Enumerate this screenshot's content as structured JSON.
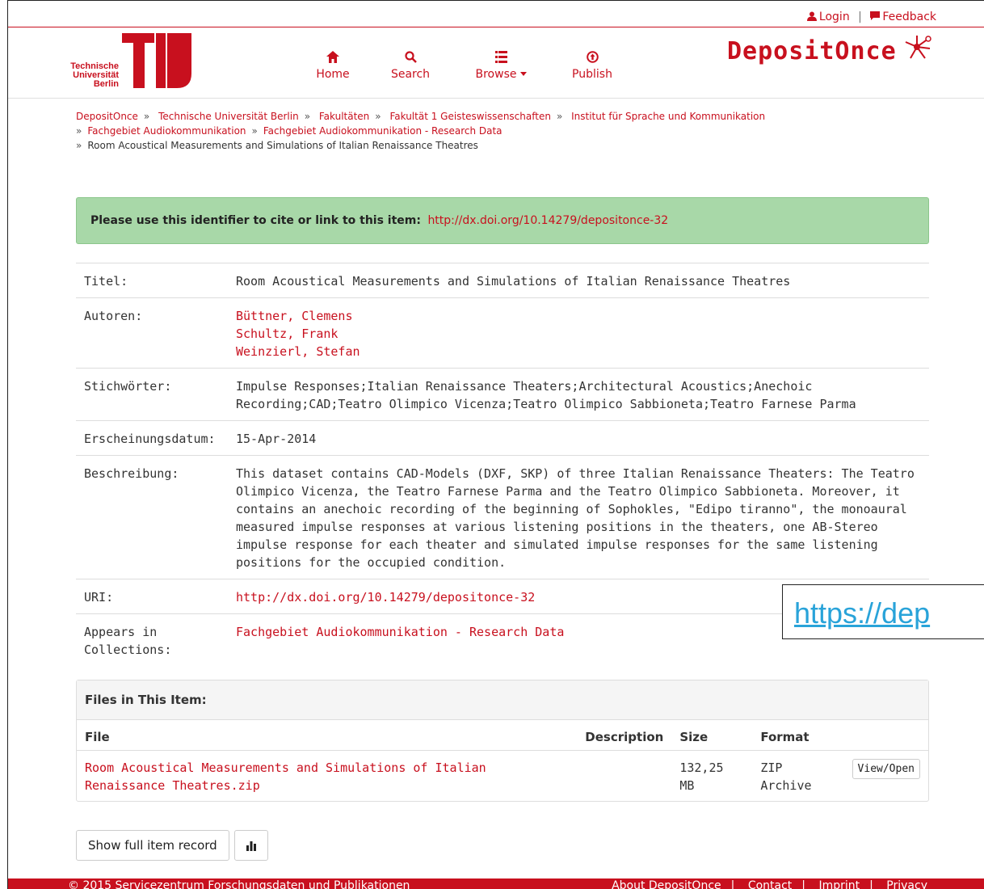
{
  "topbar": {
    "login": "Login",
    "feedback": "Feedback"
  },
  "logo": {
    "line1": "Technische",
    "line2": "Universität",
    "line3": "Berlin",
    "tag": "berlin"
  },
  "nav": {
    "home": "Home",
    "search": "Search",
    "browse": "Browse",
    "publish": "Publish"
  },
  "brand": {
    "name": "DepositOnce"
  },
  "breadcrumb": {
    "items": [
      "DepositOnce",
      "Technische Universität Berlin",
      "Fakultäten",
      "Fakultät 1 Geisteswissenschaften",
      "Institut für Sprache und Kommunikation",
      "Fachgebiet Audiokommunikation",
      "Fachgebiet Audiokommunikation - Research Data"
    ],
    "current": "Room Acoustical Measurements and Simulations of Italian Renaissance Theatres"
  },
  "citation": {
    "prefix": "Please use this identifier to cite or link to this item:",
    "url": "http://dx.doi.org/10.14279/depositonce-32"
  },
  "metadata": {
    "title_label": "Titel:",
    "title_value": "Room Acoustical Measurements and Simulations of Italian Renaissance Theatres",
    "authors_label": "Autoren:",
    "authors": [
      "Büttner, Clemens",
      "Schultz, Frank",
      "Weinzierl, Stefan"
    ],
    "keywords_label": "Stichwörter:",
    "keywords_value": "Impulse Responses;Italian Renaissance Theaters;Architectural Acoustics;Anechoic Recording;CAD;Teatro Olimpico Vicenza;Teatro Olimpico Sabbioneta;Teatro Farnese Parma",
    "date_label": "Erscheinungsdatum:",
    "date_value": "15-Apr-2014",
    "desc_label": "Beschreibung:",
    "desc_value": "This dataset contains CAD-Models (DXF, SKP) of three Italian Renaissance Theaters: The Teatro Olimpico Vicenza, the Teatro Farnese Parma and the Teatro Olimpico Sabbioneta. Moreover, it contains an anechoic recording of the beginning of Sophokles, \"Edipo tiranno\", the monoaural measured impulse responses at various listening positions in the theaters, one AB-Stereo impulse response for each theater and simulated impulse responses for the same listening positions for the occupied condition.",
    "uri_label": "URI:",
    "uri_value": "http://dx.doi.org/10.14279/depositonce-32",
    "collections_label": "Appears in Collections:",
    "collections_value": "Fachgebiet Audiokommunikation - Research Data"
  },
  "overlay": {
    "text": "https://dep"
  },
  "files": {
    "heading": "Files in This Item:",
    "columns": [
      "File",
      "Description",
      "Size",
      "Format"
    ],
    "rows": [
      {
        "file": "Room Acoustical Measurements and Simulations of Italian Renaissance Theatres.zip",
        "description": "",
        "size": "132,25 MB",
        "format": "ZIP Archive",
        "action": "View/Open"
      }
    ]
  },
  "buttons": {
    "full_record": "Show full item record"
  },
  "footer": {
    "copyright": "© 2015 Servicezentrum Forschungsdaten und Publikationen",
    "links": [
      "About DepositOnce",
      "Contact",
      "Imprint",
      "Privacy"
    ]
  }
}
